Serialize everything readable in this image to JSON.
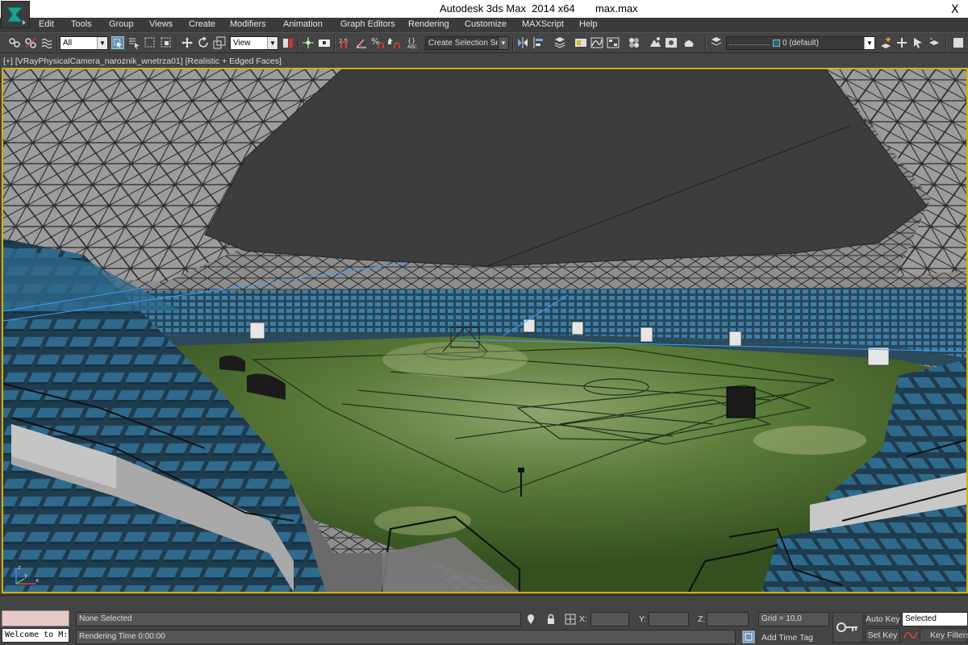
{
  "window": {
    "title": "Autodesk 3ds Max  2014 x64       max.max",
    "close_glyph": "X"
  },
  "menu": [
    "Edit",
    "Tools",
    "Group",
    "Views",
    "Create",
    "Modifiers",
    "Animation",
    "Graph Editors",
    "Rendering",
    "Customize",
    "MAXScript",
    "Help"
  ],
  "toolbar": {
    "filter_value": "All",
    "coord_value": "View",
    "selection_set_placeholder": "Create Selection Se",
    "layer_value": "0 (default)"
  },
  "viewport": {
    "label": "[+] [VRayPhysicalCamera_naroznik_wnetrza01] [Realistic + Edged Faces]",
    "axis_x": "x",
    "axis_y": "y",
    "axis_z": "z"
  },
  "status": {
    "welcome_text": "Welcome to M:",
    "selection": "None Selected",
    "rendering_time": "Rendering Time  0:00:00",
    "x_label": "X:",
    "y_label": "Y:",
    "z_label": "Z:",
    "x_value": "",
    "y_value": "",
    "z_value": "",
    "grid": "Grid = 10,0",
    "add_time_tag": "Add Time Tag",
    "auto_key": "Auto Key",
    "set_key": "Set Key",
    "selected": "Selected",
    "key_filters": "Key Filters..."
  },
  "colors": {
    "viewport_border": "#d4b200",
    "seat_blue": "#2f6a8c",
    "pitch_green": "#3f5f26",
    "roof_dark": "#3d3d3d"
  },
  "icons": [
    "logo-icon",
    "select-link-icon",
    "unlink-icon",
    "bind-space-warp-icon",
    "select-object-icon",
    "select-by-name-icon",
    "rectangle-region-icon",
    "window-crossing-icon",
    "move-icon",
    "rotate-icon",
    "scale-icon",
    "pivot-icon",
    "manipulate-icon",
    "keyboard-shortcut-icon",
    "snap-icon",
    "angle-snap-icon",
    "percent-snap-icon",
    "spinner-snap-icon",
    "edit-named-sets-icon",
    "mirror-icon",
    "align-icon",
    "layer-manager-icon",
    "graphite-icon",
    "curve-editor-icon",
    "schematic-icon",
    "material-editor-icon",
    "render-setup-icon",
    "rendered-frame-icon",
    "render-icon",
    "lock-icon",
    "absolute-mode-icon",
    "key-icon",
    "key-filters-icon"
  ]
}
